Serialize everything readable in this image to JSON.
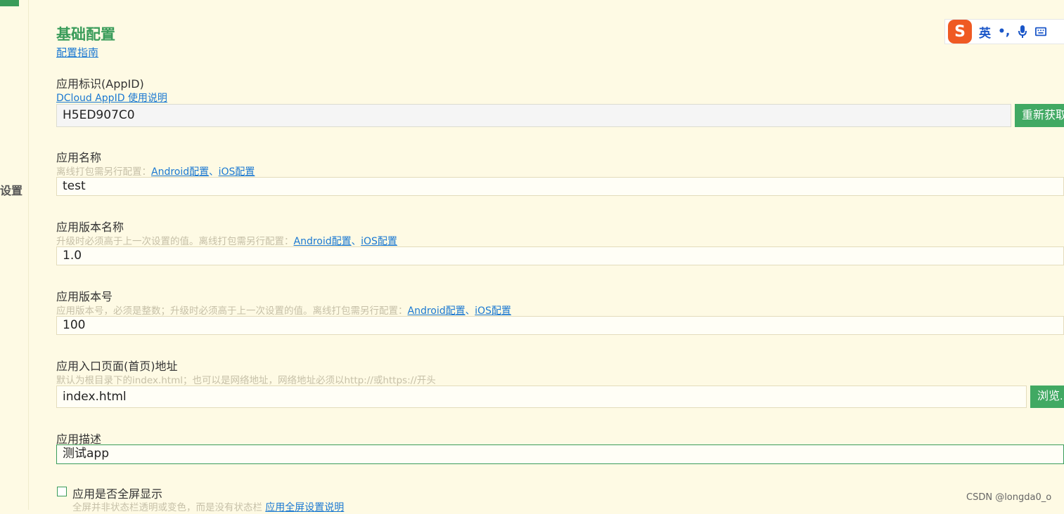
{
  "sidebar": {
    "label": "设置"
  },
  "section": {
    "title": "基础配置",
    "guide_link": "配置指南"
  },
  "appid": {
    "label": "应用标识(AppID)",
    "help_link": "DCloud AppID 使用说明",
    "value": "H5ED907C0",
    "button": "重新获取"
  },
  "app_name": {
    "label": "应用名称",
    "hint_prefix": "离线打包需另行配置：",
    "link_android": "Android配置",
    "sep": "、",
    "link_ios": "iOS配置",
    "value": "test"
  },
  "version_name": {
    "label": "应用版本名称",
    "hint_prefix": "升级时必须高于上一次设置的值。离线打包需另行配置：",
    "link_android": "Android配置",
    "sep": "、",
    "link_ios": "iOS配置",
    "value": "1.0"
  },
  "version_code": {
    "label": "应用版本号",
    "hint_prefix": "应用版本号，必须是整数；升级时必须高于上一次设置的值。离线打包需另行配置：",
    "link_android": "Android配置",
    "sep": "、",
    "link_ios": "iOS配置",
    "value": "100"
  },
  "entry_page": {
    "label": "应用入口页面(首页)地址",
    "hint": "默认为根目录下的index.html；也可以是网络地址，网络地址必须以http://或https://开头",
    "value": "index.html",
    "button": "浏览..."
  },
  "description": {
    "label": "应用描述",
    "value": "测试app"
  },
  "fullscreen": {
    "label": "应用是否全屏显示",
    "checked": false,
    "hint": "全屏并非状态栏透明或变色，而是没有状态栏",
    "link": "应用全屏设置说明"
  },
  "ime": {
    "logo": "S",
    "lang": "英",
    "punct": "•,"
  },
  "watermark": "CSDN @longda0_o",
  "colors": {
    "accent": "#3a9c5a",
    "button": "#41a963",
    "link": "#1a78d2",
    "background": "#fefae4"
  }
}
